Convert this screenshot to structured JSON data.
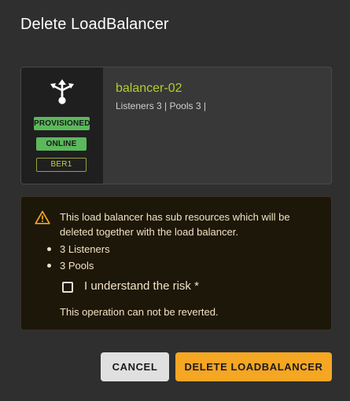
{
  "dialog": {
    "title": "Delete LoadBalancer"
  },
  "load_balancer": {
    "icon": "load-balancer-icon",
    "name": "balancer-02",
    "meta": "Listeners 3 | Pools 3 |",
    "badges": {
      "provisioning": "PROVISIONED",
      "operating": "ONLINE",
      "region": "BER1"
    }
  },
  "warning": {
    "icon": "warning-triangle-icon",
    "message": "This load balancer has sub resources which will be deleted together with the load balancer.",
    "items": [
      "3 Listeners",
      "3 Pools"
    ],
    "checkbox_label": "I understand the risk *",
    "checkbox_checked": false,
    "footer": "This operation can not be reverted."
  },
  "actions": {
    "cancel_label": "CANCEL",
    "delete_label": "DELETE LOADBALANCER"
  },
  "colors": {
    "dialog_bg": "#2f2f2f",
    "accent_name": "#b5cc2e",
    "status_green": "#5cb85c",
    "warning_bg": "#1d1709",
    "warning_icon": "#f5a623",
    "delete_button": "#f5a623"
  }
}
